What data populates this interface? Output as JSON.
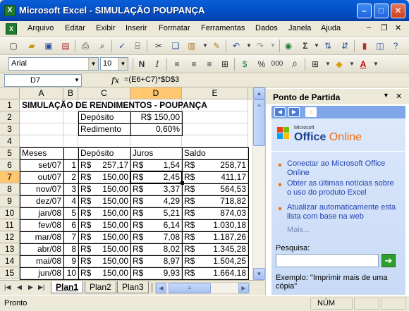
{
  "window": {
    "title": "Microsoft Excel - SIMULAÇÃO POUPANÇA"
  },
  "menu": [
    "Arquivo",
    "Editar",
    "Exibir",
    "Inserir",
    "Formatar",
    "Ferramentas",
    "Dados",
    "Janela",
    "Ajuda"
  ],
  "format": {
    "font": "Arial",
    "size": "10"
  },
  "formula_bar": {
    "name_box": "D7",
    "fx": "fx",
    "formula": "=(E6+C7)*$D$3"
  },
  "columns": [
    "A",
    "B",
    "C",
    "D",
    "E"
  ],
  "rows": [
    "1",
    "2",
    "3",
    "4",
    "5",
    "6",
    "7",
    "8",
    "9",
    "10",
    "11",
    "12",
    "13",
    "14",
    "15"
  ],
  "sheet": {
    "title": "SIMULAÇÃO DE RENDIMENTOS - POUPANÇA",
    "deposito_label": "Depósito",
    "deposito_value": "R$ 150,00",
    "rendimento_label": "Redimento",
    "rendimento_value": "0,60%",
    "headers": {
      "meses": "Meses",
      "deposito": "Depósito",
      "juros": "Juros",
      "saldo": "Saldo"
    },
    "data": [
      {
        "mes": "set/07",
        "n": "1",
        "dep": "257,17",
        "juros": "1,54",
        "saldo": "258,71"
      },
      {
        "mes": "out/07",
        "n": "2",
        "dep": "150,00",
        "juros": "2,45",
        "saldo": "411,17"
      },
      {
        "mes": "nov/07",
        "n": "3",
        "dep": "150,00",
        "juros": "3,37",
        "saldo": "564,53"
      },
      {
        "mes": "dez/07",
        "n": "4",
        "dep": "150,00",
        "juros": "4,29",
        "saldo": "718,82"
      },
      {
        "mes": "jan/08",
        "n": "5",
        "dep": "150,00",
        "juros": "5,21",
        "saldo": "874,03"
      },
      {
        "mes": "fev/08",
        "n": "6",
        "dep": "150,00",
        "juros": "6,14",
        "saldo": "1.030,18"
      },
      {
        "mes": "mar/08",
        "n": "7",
        "dep": "150,00",
        "juros": "7,08",
        "saldo": "1.187,26"
      },
      {
        "mes": "abr/08",
        "n": "8",
        "dep": "150,00",
        "juros": "8,02",
        "saldo": "1.345,28"
      },
      {
        "mes": "mai/08",
        "n": "9",
        "dep": "150,00",
        "juros": "8,97",
        "saldo": "1.504,25"
      },
      {
        "mes": "jun/08",
        "n": "10",
        "dep": "150,00",
        "juros": "9,93",
        "saldo": "1.664,18"
      }
    ],
    "currency": "R$"
  },
  "tabs": [
    "Plan1",
    "Plan2",
    "Plan3"
  ],
  "status": {
    "left": "Pronto",
    "num": "NÚM"
  },
  "taskpane": {
    "title": "Ponto de Partida",
    "logo_small": "Microsoft",
    "logo_office": "Office",
    "logo_online": "Online",
    "links": [
      "Conectar ao Microsoft Office Online",
      "Obter as últimas notícias sobre o uso do produto Excel",
      "Atualizar automaticamente esta lista com base na web"
    ],
    "more": "Mais...",
    "search_label": "Pesquisa:",
    "example": "Exemplo: \"Imprimir mais de uma cópia\""
  }
}
